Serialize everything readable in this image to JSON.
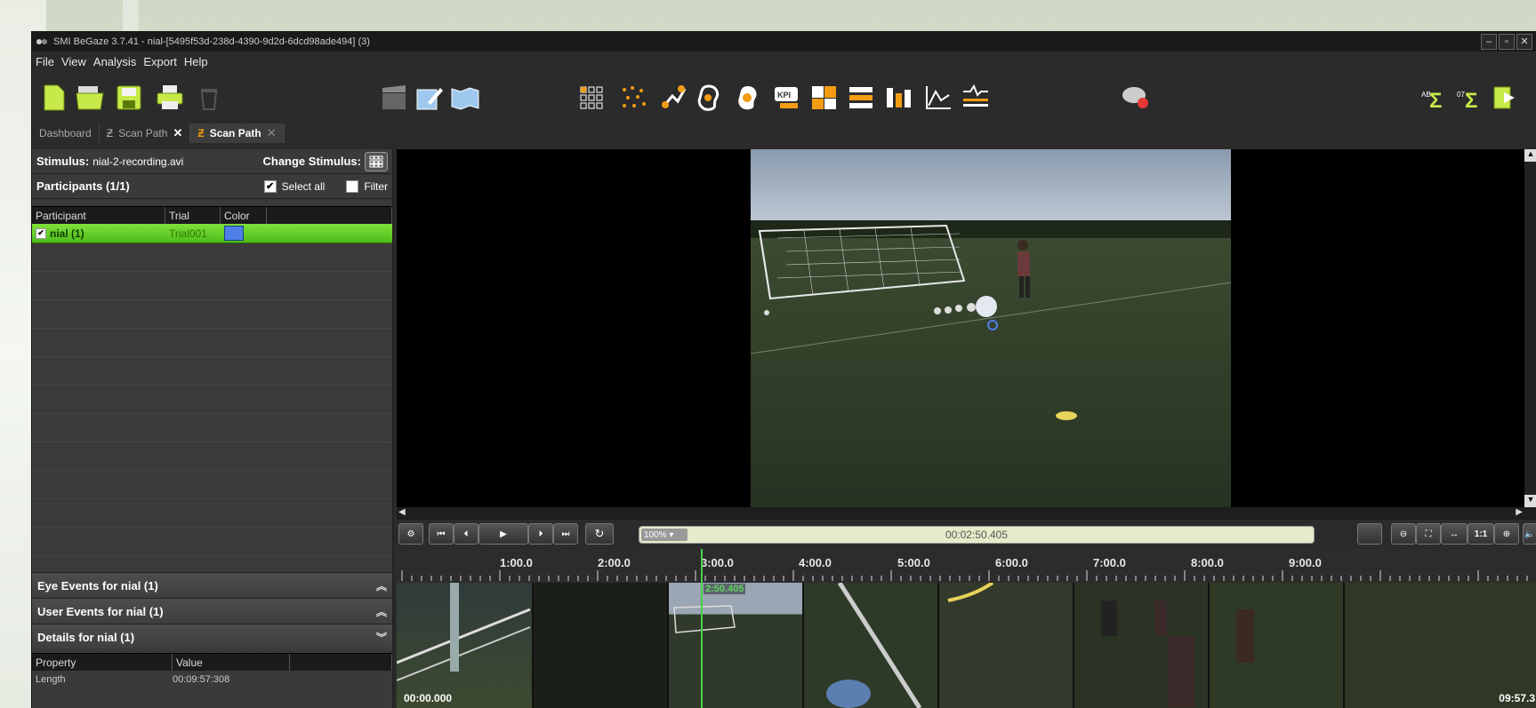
{
  "window": {
    "title": "SMI BeGaze 3.7.41 - nial-[5495f53d-238d-4390-9d2d-6dcd98ade494] (3)"
  },
  "menu": [
    "File",
    "View",
    "Analysis",
    "Export",
    "Help"
  ],
  "tabs": [
    {
      "label": "Dashboard",
      "active": false
    },
    {
      "label": "Scan Path",
      "active": false
    },
    {
      "label": "Scan Path",
      "active": true
    }
  ],
  "left": {
    "stimulus_label": "Stimulus:",
    "stimulus_value": "nial-2-recording.avi",
    "change_stimulus": "Change Stimulus:",
    "participants_title": "Participants (1/1)",
    "select_all": "Select all",
    "filter": "Filter",
    "columns": [
      "Participant",
      "Trial",
      "Color"
    ],
    "row": {
      "participant": "nial (1)",
      "trial": "Trial001",
      "color": "#4f7fe8"
    },
    "eye_events": "Eye Events for nial (1)",
    "user_events": "User Events for nial (1)",
    "details": "Details for nial (1)",
    "prop_columns": [
      "Property",
      "Value"
    ],
    "props": [
      {
        "name": "Length",
        "value": "00:09:57:308"
      }
    ]
  },
  "player": {
    "zoom": "100%",
    "current_time": "00:02:50.405",
    "progress": 0.285
  },
  "timeline": {
    "labels": [
      "1:00.0",
      "2:00.0",
      "3:00.0",
      "4:00.0",
      "5:00.0",
      "6:00.0",
      "7:00.0",
      "8:00.0",
      "9:00.0"
    ],
    "playhead_label": "2:50.405",
    "start": "00:00.000",
    "end": "09:57.3"
  }
}
